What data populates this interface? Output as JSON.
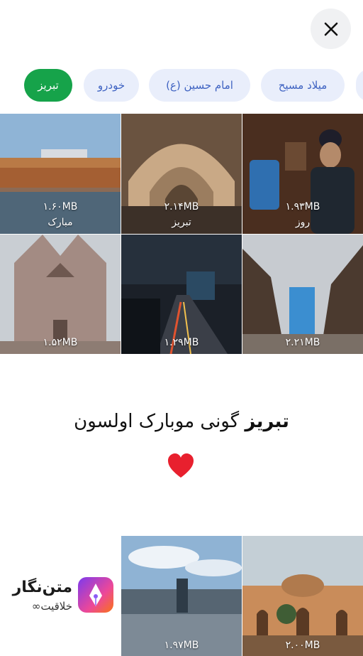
{
  "header": {
    "close_icon": "close-icon"
  },
  "chips": [
    {
      "label": "تبریز",
      "active": true
    },
    {
      "label": "خودرو",
      "active": false
    },
    {
      "label": "امام حسین (ع)",
      "active": false
    },
    {
      "label": "میلاد مسیح",
      "active": false
    }
  ],
  "grid": [
    {
      "size": "۱.۶۰MB",
      "caption": "مبارک"
    },
    {
      "size": "۲.۱۴MB",
      "caption": "تبریز"
    },
    {
      "size": "۱.۹۳MB",
      "caption": "روز"
    },
    {
      "size": "۱.۵۲MB",
      "caption": ""
    },
    {
      "size": "۱.۲۹MB",
      "caption": ""
    },
    {
      "size": "۲.۲۱MB",
      "caption": ""
    }
  ],
  "message": {
    "bold": "تبریز",
    "rest": " گونی موبارک اولسون",
    "emoji": "heart"
  },
  "brand": {
    "name": "متن‌نگار",
    "tagline": "خلاقیت∞",
    "logo_icon": "pen-nib-icon"
  },
  "bottom": [
    {
      "size": "۱.۹۷MB"
    },
    {
      "size": "۲.۰۰MB"
    }
  ],
  "colors": {
    "chip_active": "#16a34a",
    "chip_bg": "#e9eefb",
    "chip_text": "#3f63c2"
  }
}
